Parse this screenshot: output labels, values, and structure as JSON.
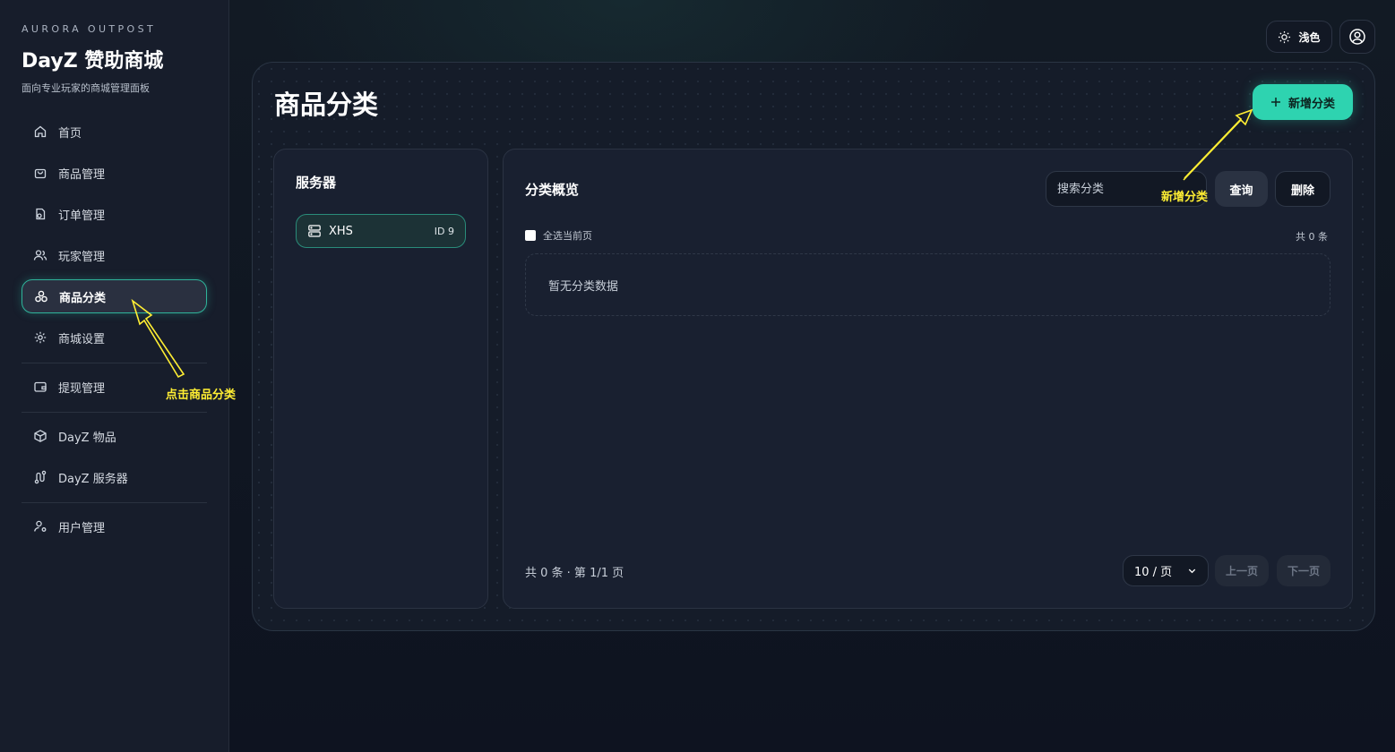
{
  "brand": {
    "kicker": "AURORA OUTPOST",
    "title": "DayZ 赞助商城",
    "subtitle": "面向专业玩家的商城管理面板"
  },
  "nav": {
    "home": "首页",
    "products": "商品管理",
    "orders": "订单管理",
    "players": "玩家管理",
    "categories": "商品分类",
    "settings": "商城设置",
    "withdraw": "提现管理",
    "dayz_items": "DayZ 物品",
    "dayz_servers": "DayZ 服务器",
    "users": "用户管理"
  },
  "topbar": {
    "theme_label": "浅色",
    "theme_icon": "sun-icon",
    "user_icon": "user-circle-icon"
  },
  "page": {
    "title": "商品分类",
    "add_button": "新增分类"
  },
  "servers": {
    "heading": "服务器",
    "items": [
      {
        "name": "XHS",
        "id": "ID 9"
      }
    ]
  },
  "overview": {
    "heading": "分类概览",
    "search_placeholder": "搜索分类",
    "query_button": "查询",
    "delete_button": "删除",
    "select_all": "全选当前页",
    "total_top": "共 0 条",
    "empty_text": "暂无分类数据",
    "footer_summary": "共 0 条 · 第 1/1 页",
    "page_size": "10 / 页",
    "prev": "上一页",
    "next": "下一页"
  },
  "annotations": {
    "click_category": "点击商品分类",
    "add_category": "新增分类"
  },
  "colors": {
    "accent": "#2ed3b0",
    "annotation": "#ffee33",
    "background": "#0f1420"
  }
}
